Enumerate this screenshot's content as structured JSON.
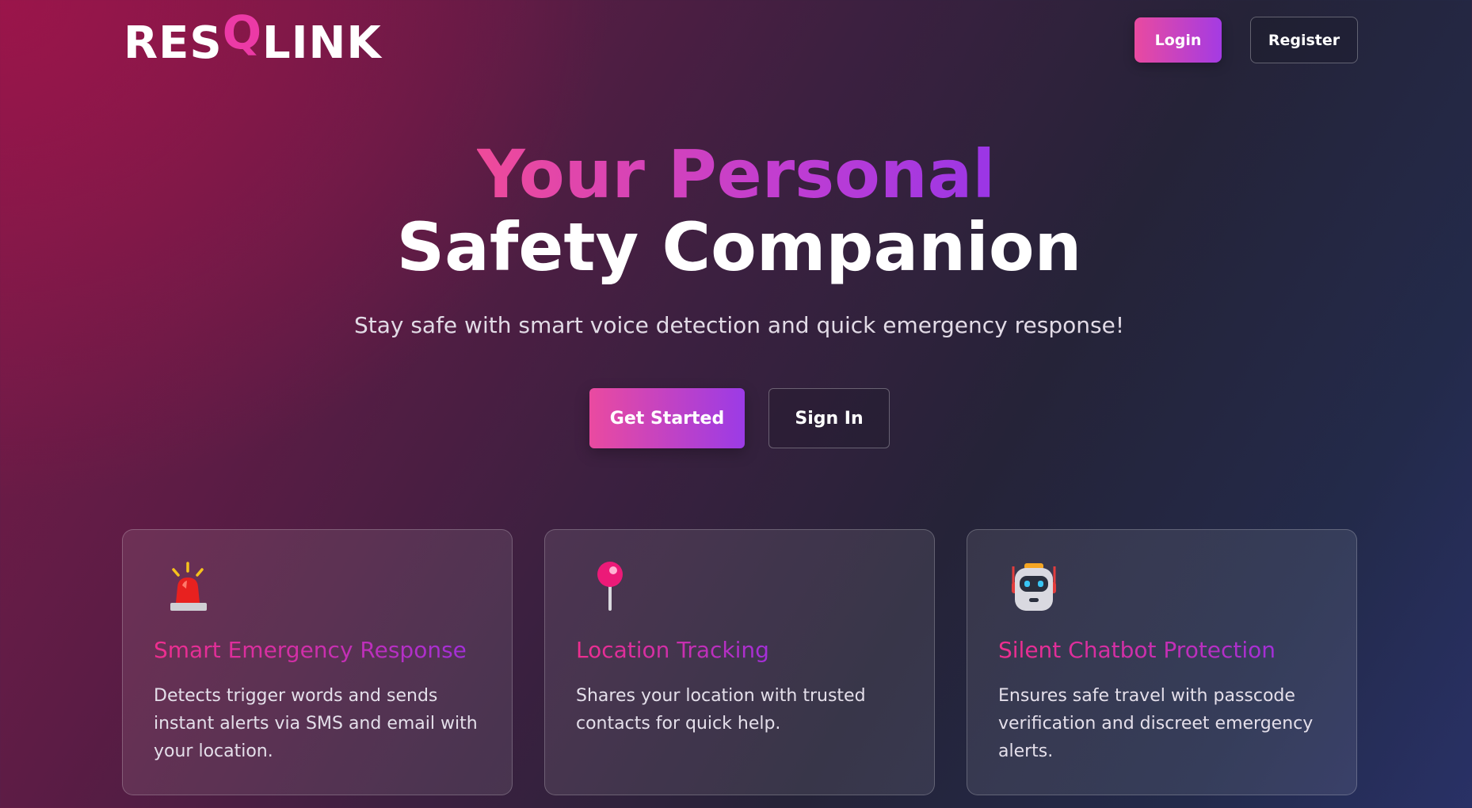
{
  "header": {
    "logo": {
      "part1": "RES",
      "part2": "Q",
      "part3": "LINK"
    },
    "login_label": "Login",
    "register_label": "Register"
  },
  "hero": {
    "title_line1": "Your Personal",
    "title_line2": "Safety Companion",
    "subtitle": "Stay safe with smart voice detection and quick emergency response!",
    "primary_cta": "Get Started",
    "secondary_cta": "Sign In"
  },
  "features": [
    {
      "icon": "siren-icon",
      "title": "Smart Emergency Response",
      "description": "Detects trigger words and sends instant alerts via SMS and email with your location."
    },
    {
      "icon": "pushpin-icon",
      "title": "Location Tracking",
      "description": "Shares your location with trusted contacts for quick help."
    },
    {
      "icon": "robot-icon",
      "title": "Silent Chatbot Protection",
      "description": "Ensures safe travel with passcode verification and discreet emergency alerts."
    }
  ],
  "colors": {
    "accent_pink": "#ec3aa6",
    "accent_purple": "#9b3be6",
    "background_dark": "#252338",
    "background_magenta": "#7d1a48"
  }
}
